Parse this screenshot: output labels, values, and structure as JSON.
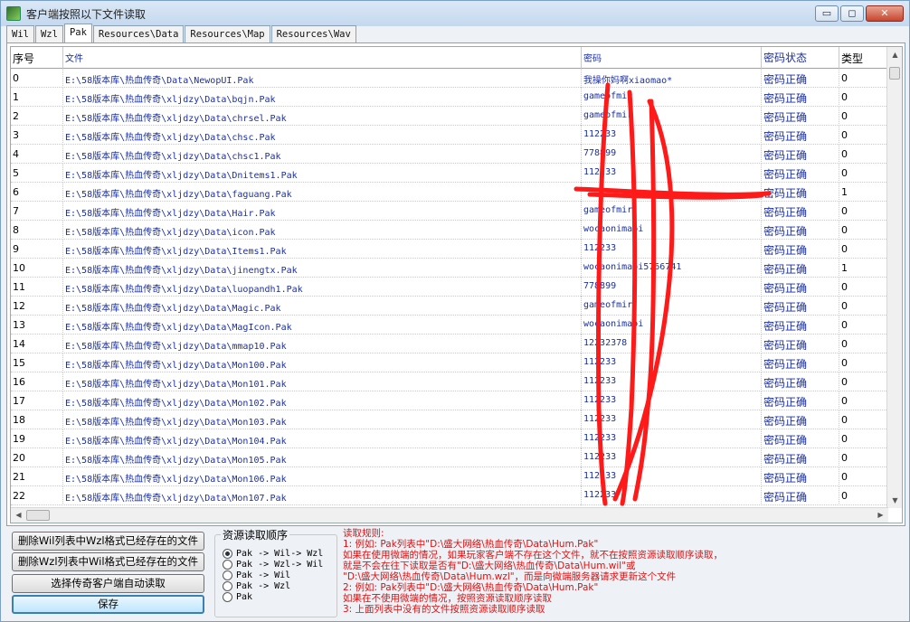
{
  "window": {
    "title": "客户端按照以下文件读取",
    "buttons": {
      "minimize": "▭",
      "maximize": "◻",
      "close": "✕"
    }
  },
  "tabs": [
    {
      "label": "Wil",
      "active": false
    },
    {
      "label": "Wzl",
      "active": false
    },
    {
      "label": "Pak",
      "active": true
    },
    {
      "label": "Resources\\Data",
      "active": false
    },
    {
      "label": "Resources\\Map",
      "active": false
    },
    {
      "label": "Resources\\Wav",
      "active": false
    }
  ],
  "table": {
    "columns": [
      "序号",
      "文件",
      "密码",
      "密码状态",
      "类型"
    ],
    "rows": [
      [
        "0",
        "E:\\58版本库\\热血传奇\\Data\\NewopUI.Pak",
        "我操你妈啊xiaomao*",
        "密码正确",
        "0"
      ],
      [
        "1",
        "E:\\58版本库\\热血传奇\\xljdzy\\Data\\bqjn.Pak",
        "gameofmir",
        "密码正确",
        "0"
      ],
      [
        "2",
        "E:\\58版本库\\热血传奇\\xljdzy\\Data\\chrsel.Pak",
        "gameofmir",
        "密码正确",
        "0"
      ],
      [
        "3",
        "E:\\58版本库\\热血传奇\\xljdzy\\Data\\chsc.Pak",
        "112233",
        "密码正确",
        "0"
      ],
      [
        "4",
        "E:\\58版本库\\热血传奇\\xljdzy\\Data\\chsc1.Pak",
        "778899",
        "密码正确",
        "0"
      ],
      [
        "5",
        "E:\\58版本库\\热血传奇\\xljdzy\\Data\\Dnitems1.Pak",
        "112233",
        "密码正确",
        "0"
      ],
      [
        "6",
        "E:\\58版本库\\热血传奇\\xljdzy\\Data\\faguang.Pak",
        "",
        "密码正确",
        "1"
      ],
      [
        "7",
        "E:\\58版本库\\热血传奇\\xljdzy\\Data\\Hair.Pak",
        "gameofmir",
        "密码正确",
        "0"
      ],
      [
        "8",
        "E:\\58版本库\\热血传奇\\xljdzy\\Data\\icon.Pak",
        "wocaonimabi",
        "密码正确",
        "0"
      ],
      [
        "9",
        "E:\\58版本库\\热血传奇\\xljdzy\\Data\\Items1.Pak",
        "112233",
        "密码正确",
        "0"
      ],
      [
        "10",
        "E:\\58版本库\\热血传奇\\xljdzy\\Data\\jinengtx.Pak",
        "wocaonimabi5766741",
        "密码正确",
        "1"
      ],
      [
        "11",
        "E:\\58版本库\\热血传奇\\xljdzy\\Data\\luopandh1.Pak",
        "778899",
        "密码正确",
        "0"
      ],
      [
        "12",
        "E:\\58版本库\\热血传奇\\xljdzy\\Data\\Magic.Pak",
        "gameofmir",
        "密码正确",
        "0"
      ],
      [
        "13",
        "E:\\58版本库\\热血传奇\\xljdzy\\Data\\MagIcon.Pak",
        "wocaonimabi",
        "密码正确",
        "0"
      ],
      [
        "14",
        "E:\\58版本库\\热血传奇\\xljdzy\\Data\\mmap10.Pak",
        "12232378",
        "密码正确",
        "0"
      ],
      [
        "15",
        "E:\\58版本库\\热血传奇\\xljdzy\\Data\\Mon100.Pak",
        "112233",
        "密码正确",
        "0"
      ],
      [
        "16",
        "E:\\58版本库\\热血传奇\\xljdzy\\Data\\Mon101.Pak",
        "112233",
        "密码正确",
        "0"
      ],
      [
        "17",
        "E:\\58版本库\\热血传奇\\xljdzy\\Data\\Mon102.Pak",
        "112233",
        "密码正确",
        "0"
      ],
      [
        "18",
        "E:\\58版本库\\热血传奇\\xljdzy\\Data\\Mon103.Pak",
        "112233",
        "密码正确",
        "0"
      ],
      [
        "19",
        "E:\\58版本库\\热血传奇\\xljdzy\\Data\\Mon104.Pak",
        "112233",
        "密码正确",
        "0"
      ],
      [
        "20",
        "E:\\58版本库\\热血传奇\\xljdzy\\Data\\Mon105.Pak",
        "112233",
        "密码正确",
        "0"
      ],
      [
        "21",
        "E:\\58版本库\\热血传奇\\xljdzy\\Data\\Mon106.Pak",
        "112233",
        "密码正确",
        "0"
      ],
      [
        "22",
        "E:\\58版本库\\热血传奇\\xljdzy\\Data\\Mon107.Pak",
        "112233",
        "密码正确",
        "0"
      ]
    ]
  },
  "buttons": {
    "delete_wil": "删除Wil列表中Wzl格式已经存在的文件",
    "delete_wzl": "删除Wzl列表中Wil格式已经存在的文件",
    "select_client": "选择传奇客户端自动读取",
    "save": "保存"
  },
  "read_order": {
    "title": "资源读取顺序",
    "options": [
      {
        "label": "Pak -> Wil-> Wzl",
        "checked": true
      },
      {
        "label": "Pak -> Wzl-> Wil",
        "checked": false
      },
      {
        "label": "Pak -> Wil",
        "checked": false
      },
      {
        "label": "Pak -> Wzl",
        "checked": false
      },
      {
        "label": "Pak",
        "checked": false
      }
    ]
  },
  "rules": {
    "lines": [
      "读取规则:",
      "1: 例如: Pak列表中\"D:\\盛大网络\\热血传奇\\Data\\Hum.Pak\"",
      "    如果在使用微端的情况，如果玩家客户端不存在这个文件，就不在按照资源读取顺序读取，",
      "    就是不会在往下读取是否有\"D:\\盛大网络\\热血传奇\\Data\\Hum.wil\"或",
      "    \"D:\\盛大网络\\热血传奇\\Data\\Hum.wzl\"，而是向微端服务器请求更新这个文件",
      "2: 例如: Pak列表中\"D:\\盛大网络\\热血传奇\\Data\\Hum.Pak\"",
      "    如果在不使用微端的情况，按照资源读取顺序读取",
      "3: 上面列表中没有的文件按照资源读取顺序读取"
    ]
  },
  "colors": {
    "link_blue": "#1a2fa6",
    "rules_red": "#e01010",
    "scribble_red": "#ff1a1a"
  }
}
